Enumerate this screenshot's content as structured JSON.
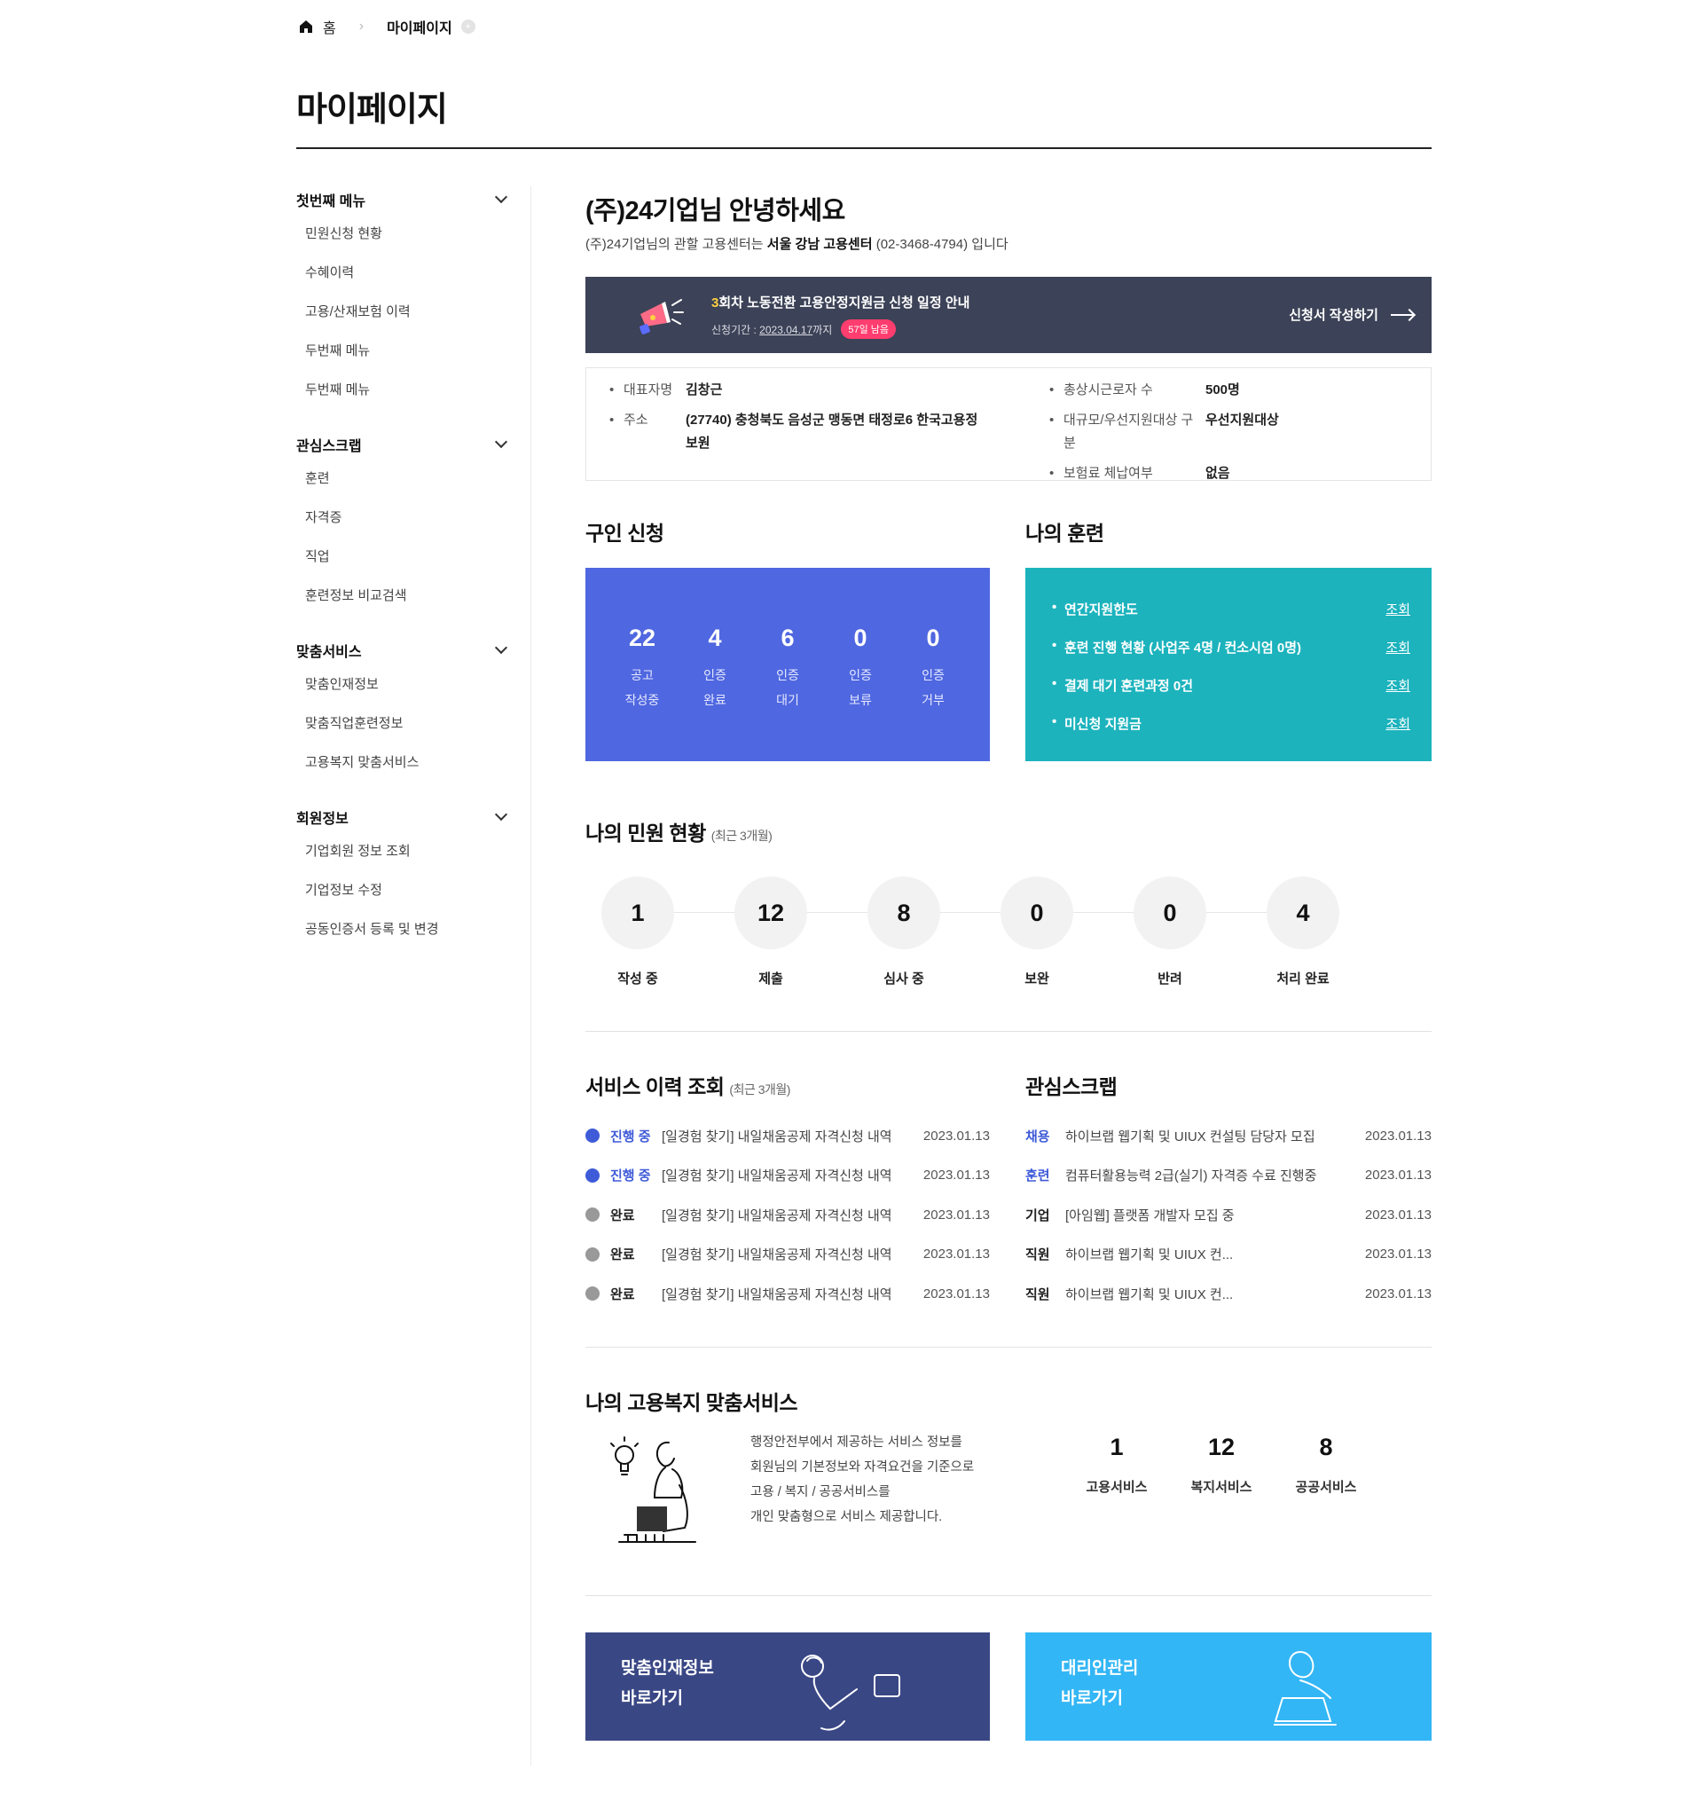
{
  "breadcrumb": {
    "home": "홈",
    "current": "마이페이지"
  },
  "page_title": "마이페이지",
  "sidebar": [
    {
      "title": "첫번째 메뉴",
      "items": [
        "민원신청 현황",
        "수혜이력",
        "고용/산재보험 이력",
        "두번째 메뉴",
        "두번째 메뉴"
      ]
    },
    {
      "title": "관심스크랩",
      "items": [
        "훈련",
        "자격증",
        "직업",
        "훈련정보 비교검색"
      ]
    },
    {
      "title": "맞춤서비스",
      "items": [
        "맞춤인재정보",
        "맞춤직업훈련정보",
        "고용복지 맞춤서비스"
      ]
    },
    {
      "title": "회원정보",
      "items": [
        "기업회원 정보 조회",
        "기업정보 수정",
        "공동인증서 등록 및 변경"
      ]
    }
  ],
  "greeting": {
    "title": "(주)24기업님 안녕하세요",
    "sub_prefix": "(주)24기업님의 관할 고용센터는 ",
    "center": "서울 강남 고용센터",
    "sub_suffix": " (02-3468-4794) 입니다"
  },
  "banner": {
    "highlight": "3",
    "title": "회차 노동전환 고용안정지원금 신청 일정 안내",
    "period_label": "신청기간 : ",
    "period_date": "2023.04.17",
    "period_suffix": "까지",
    "badge": "57일 남음",
    "cta": "신청서 작성하기"
  },
  "company_info": {
    "left": [
      {
        "key": "대표자명",
        "value": "김창근"
      },
      {
        "key": "주소",
        "value": "(27740) 충청북도 음성군 맹동면 태정로6 한국고용정보원"
      }
    ],
    "right": [
      {
        "key": "총상시근로자 수",
        "value": "500명"
      },
      {
        "key": "대규모/우선지원대상 구분",
        "value": "우선지원대상"
      },
      {
        "key": "보험료 체납여부",
        "value": "없음"
      }
    ]
  },
  "job": {
    "title": "구인 신청",
    "stats": [
      {
        "num": "22",
        "l1": "공고",
        "l2": "작성중"
      },
      {
        "num": "4",
        "l1": "인증",
        "l2": "완료"
      },
      {
        "num": "6",
        "l1": "인증",
        "l2": "대기"
      },
      {
        "num": "0",
        "l1": "인증",
        "l2": "보류"
      },
      {
        "num": "0",
        "l1": "인증",
        "l2": "거부"
      }
    ]
  },
  "training": {
    "title": "나의 훈련",
    "link_label": "조회",
    "rows": [
      "연간지원한도",
      "훈련 진행 현황 (사업주 4명 / 컨소시엄 0명)",
      "결제 대기 훈련과정 0건",
      "미신청 지원금"
    ]
  },
  "civil": {
    "title": "나의 민원 현황",
    "note": "(최근 3개월)",
    "items": [
      {
        "num": "1",
        "label": "작성 중"
      },
      {
        "num": "12",
        "label": "제출"
      },
      {
        "num": "8",
        "label": "심사 중"
      },
      {
        "num": "0",
        "label": "보완"
      },
      {
        "num": "0",
        "label": "반려"
      },
      {
        "num": "4",
        "label": "처리 완료"
      }
    ]
  },
  "service_history": {
    "title": "서비스 이력 조회",
    "note": "(최근 3개월)",
    "rows": [
      {
        "status": "진행 중",
        "active": true,
        "text": "[일경험 찾기] 내일채움공제 자격신청 내역",
        "date": "2023.01.13"
      },
      {
        "status": "진행 중",
        "active": true,
        "text": "[일경험 찾기] 내일채움공제 자격신청 내역",
        "date": "2023.01.13"
      },
      {
        "status": "완료",
        "active": false,
        "text": "[일경험 찾기] 내일채움공제 자격신청 내역",
        "date": "2023.01.13"
      },
      {
        "status": "완료",
        "active": false,
        "text": "[일경험 찾기] 내일채움공제 자격신청 내역",
        "date": "2023.01.13"
      },
      {
        "status": "완료",
        "active": false,
        "text": "[일경험 찾기] 내일채움공제 자격신청 내역",
        "date": "2023.01.13"
      }
    ]
  },
  "scrap": {
    "title": "관심스크랩",
    "rows": [
      {
        "cat": "채용",
        "active": true,
        "text": "하이브랩 웹기획 및 UIUX 컨설팅 담당자 모집",
        "date": "2023.01.13"
      },
      {
        "cat": "훈련",
        "active": true,
        "text": "컴퓨터활용능력 2급(실기) 자격증 수료 진행중",
        "date": "2023.01.13"
      },
      {
        "cat": "기업",
        "active": false,
        "text": "[아임웹] 플랫폼 개발자 모집 중",
        "date": "2023.01.13"
      },
      {
        "cat": "직원",
        "active": false,
        "text": "하이브랩 웹기획 및 UIUX 컨...",
        "date": "2023.01.13"
      },
      {
        "cat": "직원",
        "active": false,
        "text": "하이브랩 웹기획 및 UIUX 컨...",
        "date": "2023.01.13"
      }
    ]
  },
  "welfare": {
    "title": "나의 고용복지 맞춤서비스",
    "desc": [
      "행정안전부에서 제공하는 서비스 정보를",
      "회원님의 기본정보와 자격요건을 기준으로",
      "고용 / 복지 / 공공서비스를",
      "개인 맞춤형으로 서비스 제공합니다."
    ],
    "stats": [
      {
        "num": "1",
        "label": "고용서비스"
      },
      {
        "num": "12",
        "label": "복지서비스"
      },
      {
        "num": "8",
        "label": "공공서비스"
      }
    ]
  },
  "quick_links": [
    {
      "l1": "맞춤인재정보",
      "l2": "바로가기",
      "color": "#3a4785"
    },
    {
      "l1": "대리인관리",
      "l2": "바로가기",
      "color": "#33b6f5"
    }
  ],
  "colors": {
    "primary_blue": "#4f67e0",
    "teal": "#1cb3bd",
    "banner_bg": "#3c4257",
    "badge": "#ff3d6e",
    "status_blue": "#3f5bd8",
    "status_gray": "#999999"
  }
}
